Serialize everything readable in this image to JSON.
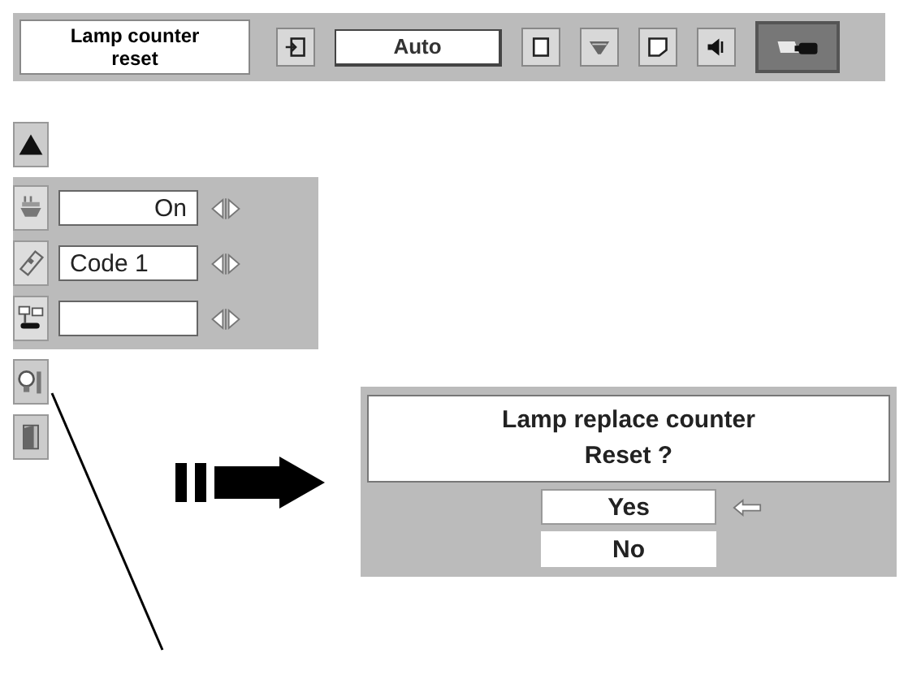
{
  "toolbar": {
    "title": "Lamp counter reset",
    "tools": [
      {
        "kind": "icon",
        "selected": false
      },
      {
        "kind": "field",
        "value": "Auto",
        "selected": false
      },
      {
        "kind": "icon",
        "selected": false
      },
      {
        "kind": "icon",
        "selected": false
      },
      {
        "kind": "icon",
        "selected": false
      },
      {
        "kind": "icon",
        "selected": false
      },
      {
        "kind": "wide-icon",
        "selected": true
      }
    ]
  },
  "settings": [
    {
      "kind": "toggle",
      "value": "On"
    },
    {
      "kind": "select",
      "value": "Code 1"
    },
    {
      "kind": "select"
    }
  ],
  "dialog": {
    "lines": [
      "Lamp replace counter",
      "Reset ?"
    ],
    "options": [
      {
        "label": "Yes",
        "selected": true
      },
      {
        "label": "No",
        "selected": false
      }
    ]
  }
}
